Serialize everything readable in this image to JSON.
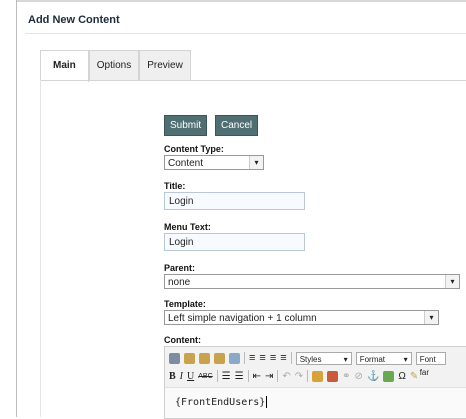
{
  "page": {
    "title": "Add New Content"
  },
  "tabs": [
    {
      "label": "Main"
    },
    {
      "label": "Options"
    },
    {
      "label": "Preview"
    }
  ],
  "actions": {
    "submit_label": "Submit",
    "cancel_label": "Cancel"
  },
  "fields": {
    "content_type": {
      "label": "Content Type:",
      "value": "Content"
    },
    "title": {
      "label": "Title:",
      "value": "Login"
    },
    "menu_text": {
      "label": "Menu Text:",
      "value": "Login"
    },
    "parent": {
      "label": "Parent:",
      "value": "none"
    },
    "template": {
      "label": "Template:",
      "value": "Left simple navigation + 1 column"
    },
    "content": {
      "label": "Content:",
      "value": "{FrontEndUsers}"
    }
  },
  "editor": {
    "styles_label": "Styles",
    "format_label": "Format",
    "font_label": "Font far",
    "row1_icons": [
      "cut-icon",
      "copy-icon",
      "paste-icon",
      "paste-text-icon",
      "paste-word-icon",
      "align-left-icon",
      "align-center-icon",
      "align-right-icon",
      "align-justify-icon"
    ],
    "row2_labels": {
      "bold": "B",
      "italic": "I",
      "underline": "U",
      "strike": "ABC"
    }
  },
  "colors": {
    "button_bg": "#4f6f73",
    "input_bg": "#f7fbff"
  }
}
